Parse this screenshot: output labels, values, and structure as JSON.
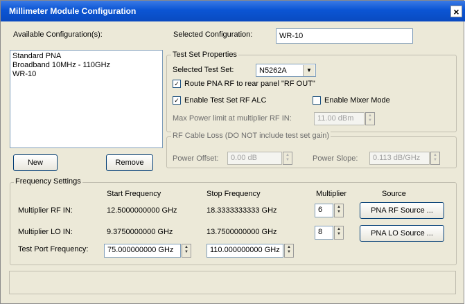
{
  "window": {
    "title": "Millimeter Module Configuration",
    "close_glyph": "×"
  },
  "configs": {
    "available_label": "Available Configuration(s):",
    "items": [
      "Standard PNA",
      "Broadband 10MHz - 110GHz",
      "WR-10"
    ],
    "new_label": "New",
    "remove_label": "Remove"
  },
  "selected_config": {
    "label": "Selected Configuration:",
    "value": "WR-10"
  },
  "test_set": {
    "group_label": "Test Set Properties",
    "selected_label": "Selected Test Set:",
    "selected_value": "N5262A",
    "route_label": "Route PNA RF to rear panel \"RF OUT\"",
    "route_checked": true,
    "alc_label": "Enable Test Set RF ALC",
    "alc_checked": true,
    "mixer_label": "Enable Mixer Mode",
    "mixer_checked": false,
    "max_power_label": "Max Power limit at multiplier RF IN:",
    "max_power_value": "11.00 dBm"
  },
  "cable_loss": {
    "group_label": "RF Cable Loss (DO NOT include test set gain)",
    "offset_label": "Power Offset:",
    "offset_value": "0.00 dB",
    "slope_label": "Power Slope:",
    "slope_value": "0.113 dB/GHz"
  },
  "freq": {
    "group_label": "Frequency Settings",
    "headers": {
      "start": "Start Frequency",
      "stop": "Stop Frequency",
      "multiplier": "Multiplier",
      "source": "Source"
    },
    "rf": {
      "label": "Multiplier RF IN:",
      "start": "12.5000000000 GHz",
      "stop": "18.3333333333 GHz",
      "mult": "6",
      "source_btn": "PNA RF Source ..."
    },
    "lo": {
      "label": "Multiplier LO IN:",
      "start": "9.3750000000 GHz",
      "stop": "13.7500000000 GHz",
      "mult": "8",
      "source_btn": "PNA LO Source ..."
    },
    "port": {
      "label": "Test Port Frequency:",
      "start": "75.000000000 GHz",
      "stop": "110.000000000 GHz"
    }
  }
}
